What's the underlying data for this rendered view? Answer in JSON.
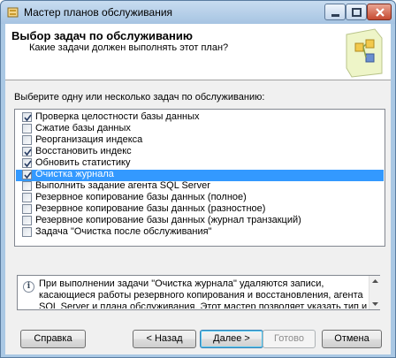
{
  "window": {
    "title": "Мастер планов обслуживания"
  },
  "header": {
    "title": "Выбор задач по обслуживанию",
    "subtitle": "Какие задачи должен выполнять этот план?"
  },
  "prompt": "Выберите одну или несколько задач по обслуживанию:",
  "tasks": [
    {
      "label": "Проверка целостности базы данных",
      "checked": true,
      "selected": false
    },
    {
      "label": "Сжатие базы данных",
      "checked": false,
      "selected": false
    },
    {
      "label": "Реорганизация индекса",
      "checked": false,
      "selected": false
    },
    {
      "label": "Восстановить индекс",
      "checked": true,
      "selected": false
    },
    {
      "label": "Обновить статистику",
      "checked": true,
      "selected": false
    },
    {
      "label": "Очистка журнала",
      "checked": true,
      "selected": true
    },
    {
      "label": "Выполнить задание агента SQL Server",
      "checked": false,
      "selected": false
    },
    {
      "label": "Резервное копирование базы данных (полное)",
      "checked": false,
      "selected": false
    },
    {
      "label": "Резервное копирование базы данных (разностное)",
      "checked": false,
      "selected": false
    },
    {
      "label": "Резервное копирование базы данных (журнал транзакций)",
      "checked": false,
      "selected": false
    },
    {
      "label": "Задача \"Очистка после обслуживания\"",
      "checked": false,
      "selected": false
    }
  ],
  "description": "При выполнении задачи \"Очистка журнала\" удаляются записи, касающиеся работы резервного копирования и восстановления, агента SQL Server и плана обслуживания. Этот мастер позволяет указать тип и возраст данных, подлежащих удалению.",
  "buttons": {
    "help": "Справка",
    "back": "< Назад",
    "next": "Далее >",
    "finish": "Готово",
    "cancel": "Отмена"
  },
  "colors": {
    "selection": "#3399ff",
    "title_bar": "#b9d1ea",
    "dialog_background": "#f0f0f0"
  }
}
